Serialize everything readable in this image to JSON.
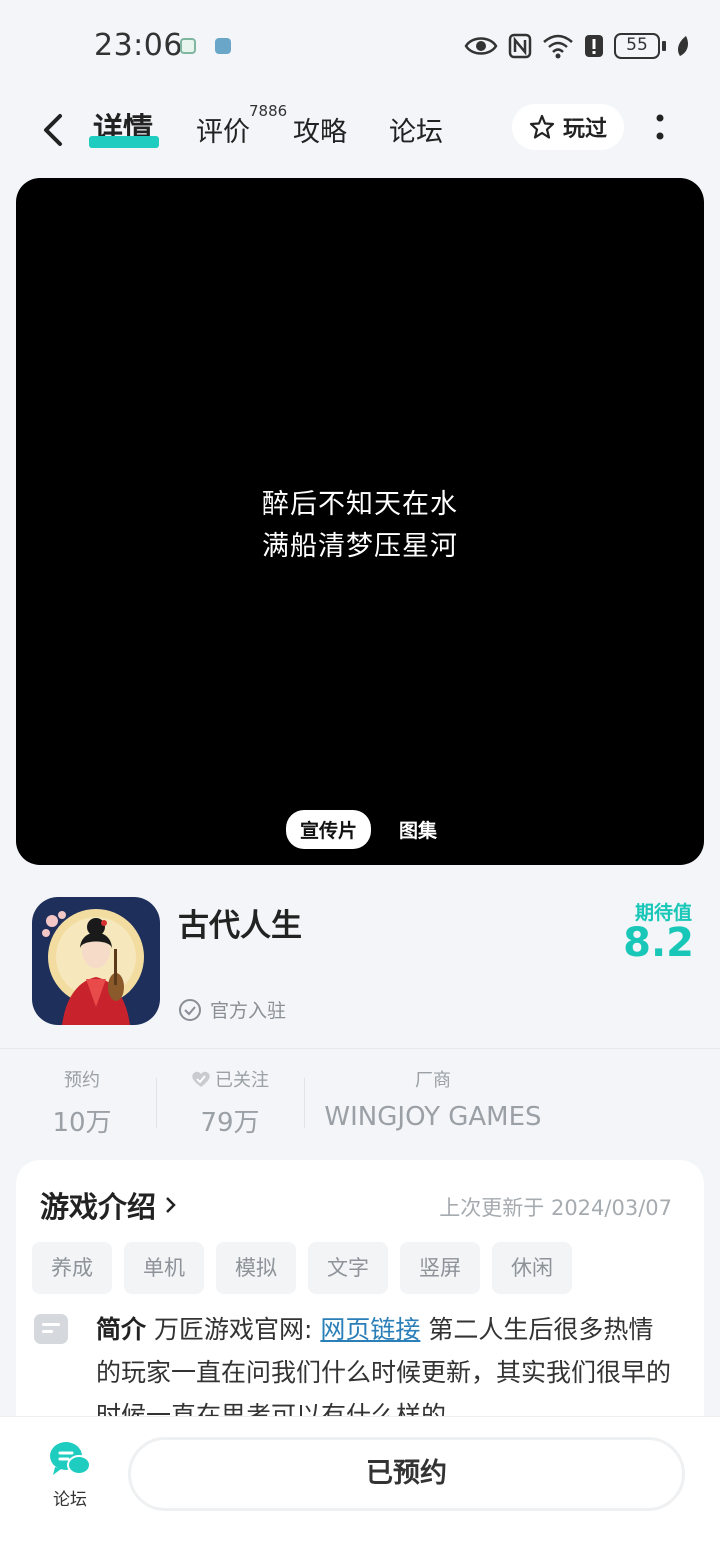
{
  "status_bar": {
    "time": "23:06",
    "battery": "55",
    "icons": [
      "shield-icon",
      "app-icon",
      "eye-icon",
      "nfc-icon",
      "wifi-icon",
      "alert-icon",
      "battery-icon",
      "leaf-icon"
    ]
  },
  "nav": {
    "tabs": [
      {
        "label": "详情"
      },
      {
        "label": "评价"
      },
      {
        "label": "攻略"
      },
      {
        "label": "论坛"
      }
    ],
    "review_count": "7886",
    "played_label": "玩过"
  },
  "media": {
    "caption_line1": "醉后不知天在水",
    "caption_line2": "满船清梦压星河",
    "tabs": [
      "宣传片",
      "图集"
    ]
  },
  "game": {
    "title": "古代人生",
    "official_label": "官方入驻",
    "score_label": "期待值",
    "score": "8.2"
  },
  "stats": {
    "reserve_label": "预约",
    "reserve_value": "10万",
    "follow_label": "已关注",
    "follow_value": "79万",
    "vendor_label": "厂商",
    "vendor_value": "WINGJOY GAMES"
  },
  "intro": {
    "title": "游戏介绍",
    "updated": "上次更新于 2024/03/07",
    "tags": [
      "养成",
      "单机",
      "模拟",
      "文字",
      "竖屏",
      "休闲"
    ],
    "label": "简介",
    "text_before_link": "万匠游戏官网:",
    "link": "网页链接",
    "text_after_link": "第二人生后很多热情的玩家一直在问我们什么时候更新，其实我们很早的时候一直在思考可以有什么样的"
  },
  "bottom": {
    "forum_label": "论坛",
    "reserve_button": "已预约"
  },
  "colors": {
    "accent": "#1ecdc0",
    "score": "#19c7b8",
    "link": "#2a7fb8"
  }
}
